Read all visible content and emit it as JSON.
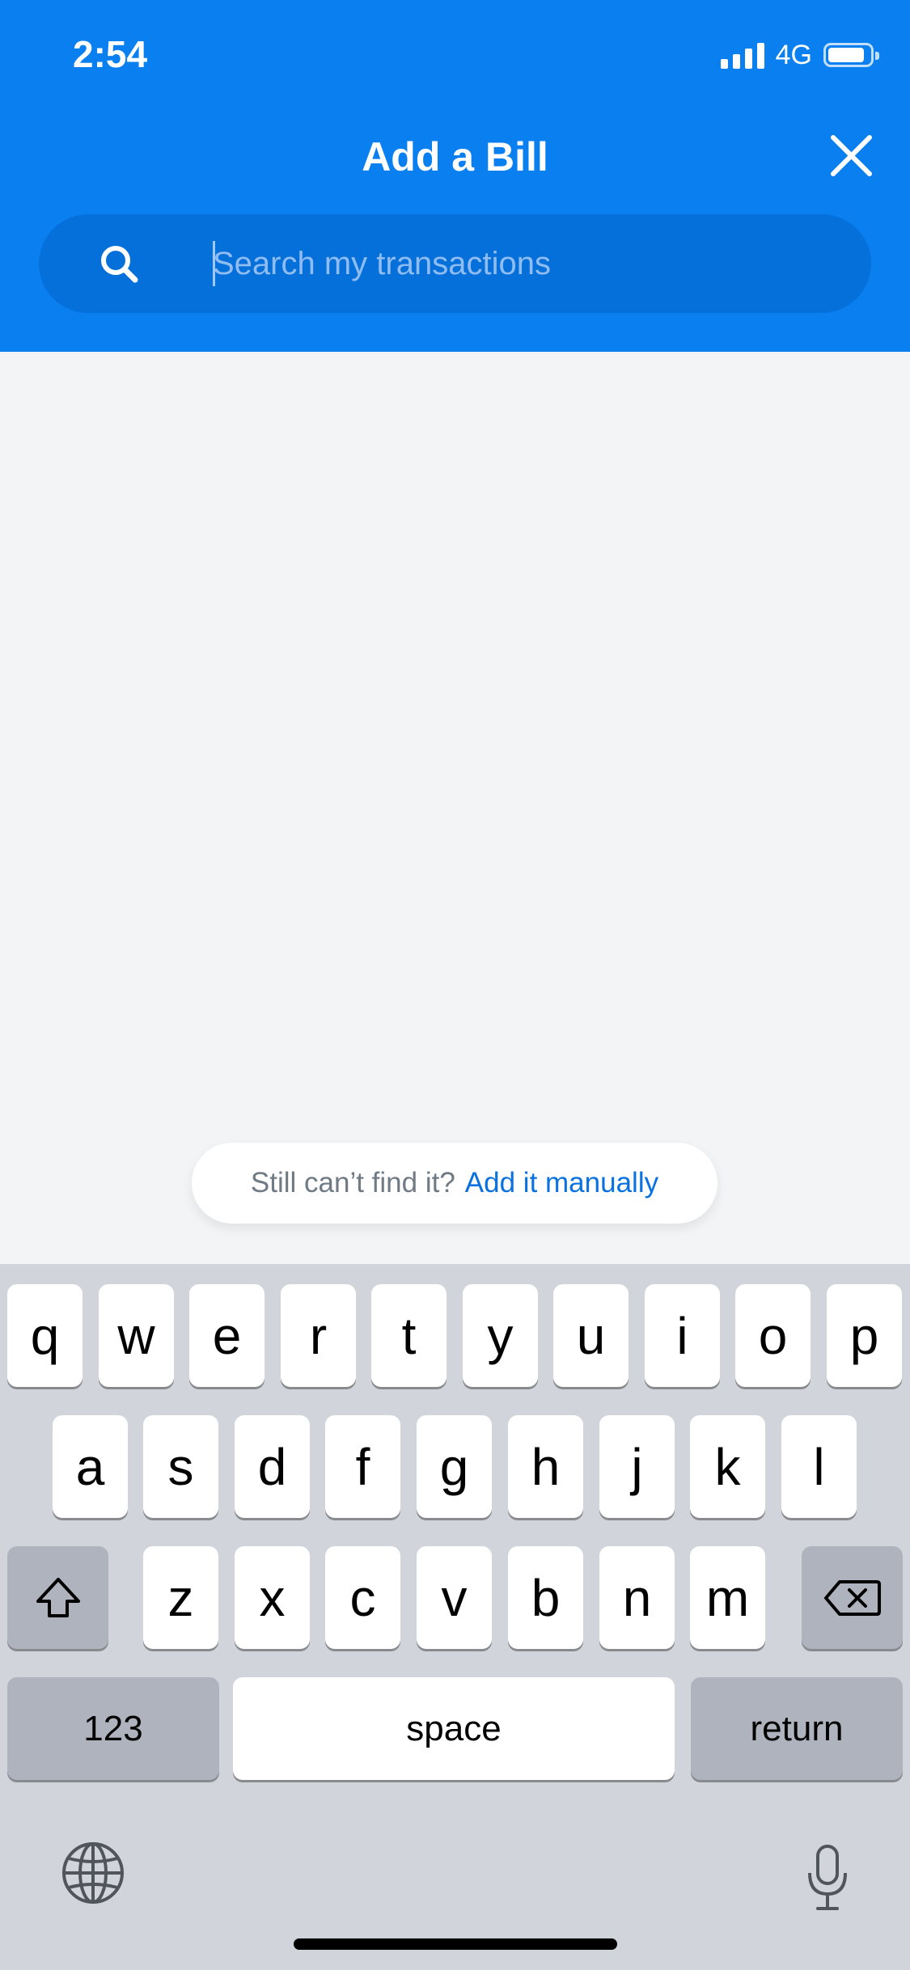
{
  "status_bar": {
    "time": "2:54",
    "network": "4G"
  },
  "header": {
    "title": "Add a Bill"
  },
  "search": {
    "placeholder": "Search my transactions",
    "value": ""
  },
  "hint": {
    "text": "Still can’t find it?",
    "link": "Add it manually"
  },
  "keyboard": {
    "row1": [
      "q",
      "w",
      "e",
      "r",
      "t",
      "y",
      "u",
      "i",
      "o",
      "p"
    ],
    "row2": [
      "a",
      "s",
      "d",
      "f",
      "g",
      "h",
      "j",
      "k",
      "l"
    ],
    "row3": [
      "z",
      "x",
      "c",
      "v",
      "b",
      "n",
      "m"
    ],
    "numbers_label": "123",
    "space_label": "space",
    "return_label": "return"
  },
  "colors": {
    "header": "#0a7ff0",
    "link": "#0a72e0",
    "background": "#f3f4f6"
  },
  "icons": [
    "search-icon",
    "close-icon",
    "shift-icon",
    "backspace-icon",
    "globe-icon",
    "microphone-icon"
  ]
}
